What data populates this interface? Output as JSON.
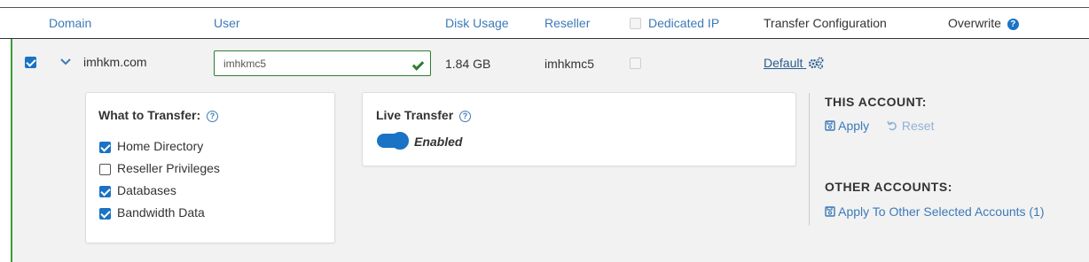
{
  "header": {
    "domain": "Domain",
    "user": "User",
    "disk_usage": "Disk Usage",
    "reseller": "Reseller",
    "dedicated_ip": "Dedicated IP",
    "transfer_configuration": "Transfer Configuration",
    "overwrite": "Overwrite",
    "overwrite_help_glyph": "?"
  },
  "row": {
    "selected": true,
    "domain": "imhkm.com",
    "user_value": "imhkmc5",
    "disk_usage": "1.84 GB",
    "reseller": "imhkmc5",
    "dedicated_ip": false,
    "transfer_config": "Default"
  },
  "what_to_transfer": {
    "title": "What to Transfer:",
    "help_glyph": "?",
    "options": [
      {
        "label": "Home Directory",
        "checked": true
      },
      {
        "label": "Reseller Privileges",
        "checked": false
      },
      {
        "label": "Databases",
        "checked": true
      },
      {
        "label": "Bandwidth Data",
        "checked": true
      }
    ]
  },
  "live_transfer": {
    "title": "Live Transfer",
    "help_glyph": "?",
    "status": "Enabled",
    "enabled": true
  },
  "this_account": {
    "title": "THIS ACCOUNT:",
    "apply_label": "Apply",
    "reset_label": "Reset"
  },
  "other_accounts": {
    "title": "OTHER ACCOUNTS:",
    "apply_label": "Apply To Other Selected Accounts (1)"
  },
  "colors": {
    "accent": "#1a73c4",
    "link": "#3d7ab8",
    "success": "#2e7d32",
    "row_border": "#3a9d3a"
  }
}
